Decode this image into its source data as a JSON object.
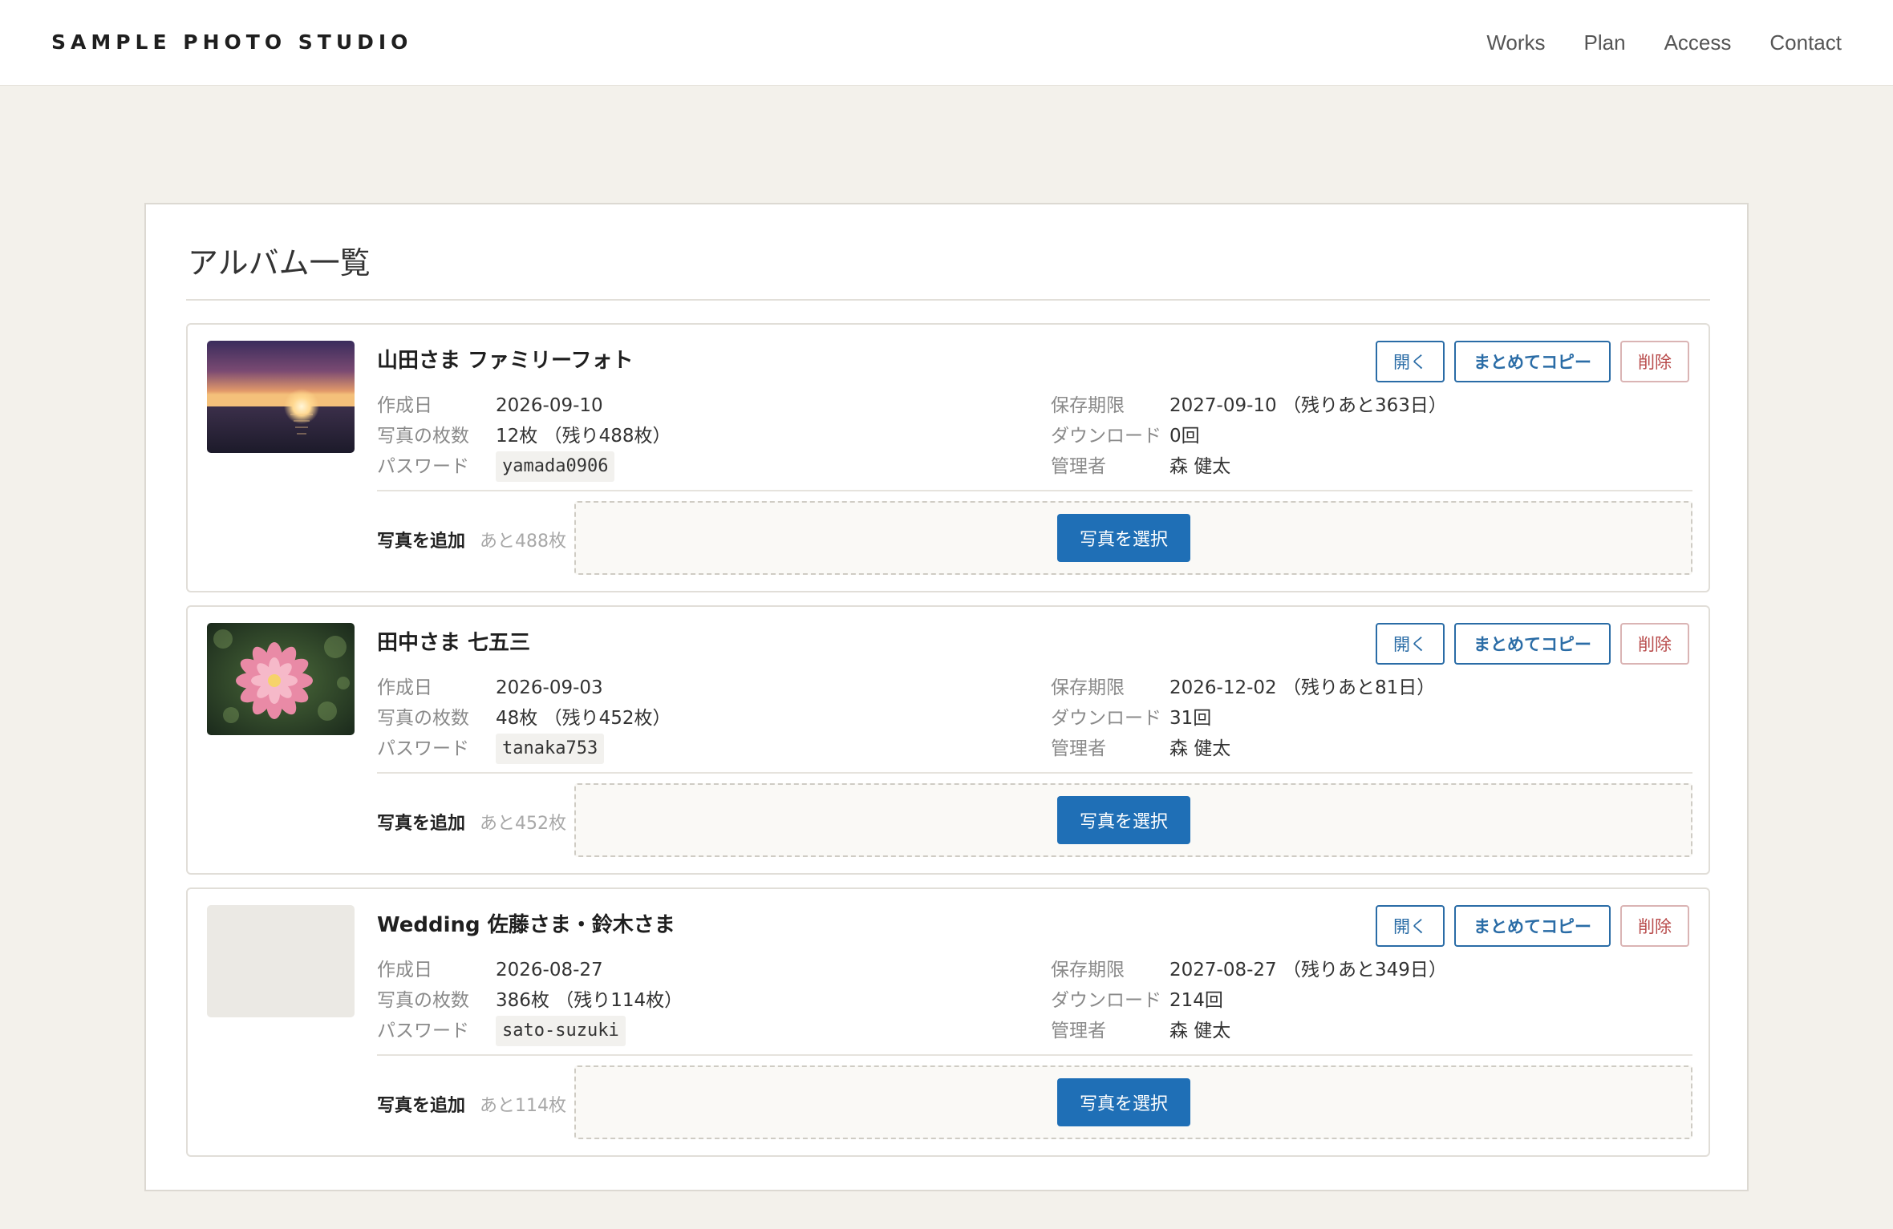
{
  "header": {
    "brand": "SAMPLE PHOTO STUDIO",
    "nav": [
      "Works",
      "Plan",
      "Access",
      "Contact"
    ]
  },
  "page": {
    "title": "アルバム一覧"
  },
  "labels": {
    "created": "作成日",
    "photo_count": "写真の枚数",
    "password": "パスワード",
    "expiry": "保存期限",
    "downloads": "ダウンロード",
    "manager": "管理者",
    "add_photos": "写真を追加",
    "open": "開く",
    "copy_all": "まとめてコピー",
    "delete": "削除",
    "select_photos": "写真を選択"
  },
  "albums": [
    {
      "title": "山田さま ファミリーフォト",
      "thumbnail": "sunset-photo",
      "created": "2026-09-10",
      "photo_count": "12枚 （残り488枚）",
      "password": "yamada0906",
      "expiry": "2027-09-10 （残りあと363日）",
      "downloads": "0回",
      "manager": "森 健太",
      "remaining": "あと488枚"
    },
    {
      "title": "田中さま 七五三",
      "thumbnail": "flower-photo",
      "created": "2026-09-03",
      "photo_count": "48枚 （残り452枚）",
      "password": "tanaka753",
      "expiry": "2026-12-02 （残りあと81日）",
      "downloads": "31回",
      "manager": "森 健太",
      "remaining": "あと452枚"
    },
    {
      "title": "Wedding 佐藤さま・鈴木さま",
      "thumbnail": "",
      "created": "2026-08-27",
      "photo_count": "386枚 （残り114枚）",
      "password": "sato-suzuki",
      "expiry": "2027-08-27 （残りあと349日）",
      "downloads": "214回",
      "manager": "森 健太",
      "remaining": "あと114枚"
    }
  ]
}
